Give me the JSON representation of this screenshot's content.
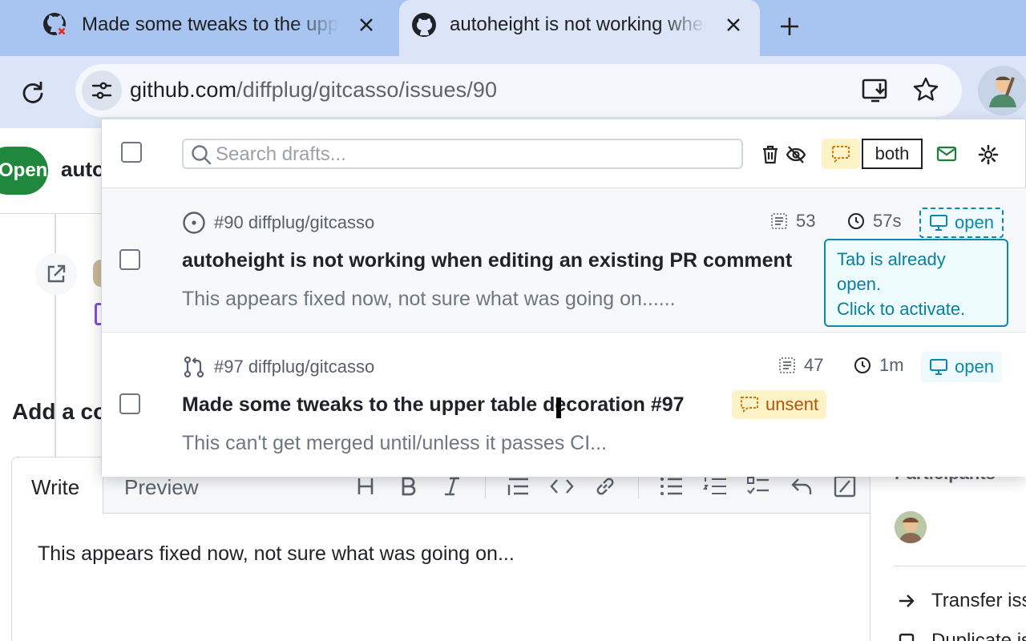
{
  "browser": {
    "tabs": [
      {
        "title": "Made some tweaks to the upper table decoration",
        "active": false
      },
      {
        "title": "autoheight is not working when editing an existing PR comment",
        "active": true
      }
    ],
    "url_host": "github.com",
    "url_path": "/diffplug/gitcasso/issues/90"
  },
  "page": {
    "issue_state": "Open",
    "issue_title_fragment": "auto",
    "add_comment_heading": "Add a co",
    "editor": {
      "tab_write": "Write",
      "tab_preview": "Preview",
      "toolbar_icons": [
        "heading-icon",
        "bold-icon",
        "italic-icon",
        "quote-icon",
        "code-icon",
        "link-icon",
        "bullet-list-icon",
        "numbered-list-icon",
        "task-list-icon",
        "reply-icon",
        "slash-icon"
      ],
      "text": "This appears fixed now, not sure what was going on..."
    },
    "sidebar": {
      "participants_label": "Participants",
      "transfer_label": "Transfer iss",
      "duplicate_label": "Duplicate is"
    }
  },
  "popup": {
    "search_placeholder": "Search drafts...",
    "filter_label": "both",
    "drafts": [
      {
        "kind": "issue",
        "meta": "#90 diffplug/gitcasso",
        "title": "autoheight is not working when editing an existing PR comment",
        "snippet": "This appears fixed now, not sure what was going on......",
        "chars": "53",
        "age": "57s",
        "open_label": "open"
      },
      {
        "kind": "pull-request",
        "meta": "#97 diffplug/gitcasso",
        "title": "Made some tweaks to the upper table decoration #97",
        "snippet": "This can't get merged until/unless it passes CI...",
        "chars": "47",
        "age": "1m",
        "open_label": "open",
        "badge": "unsent"
      }
    ],
    "tooltip": {
      "line1": "Tab is already",
      "line2": "open.",
      "line3": "Click to activate."
    }
  },
  "colors": {
    "tabstrip": "#a8c4f0",
    "toolbar": "#dbe5f7",
    "gh_green": "#1f883d",
    "accent_teal": "#0a8aa8",
    "unsent_bg": "#fef3c7",
    "unsent_text": "#b45309"
  }
}
